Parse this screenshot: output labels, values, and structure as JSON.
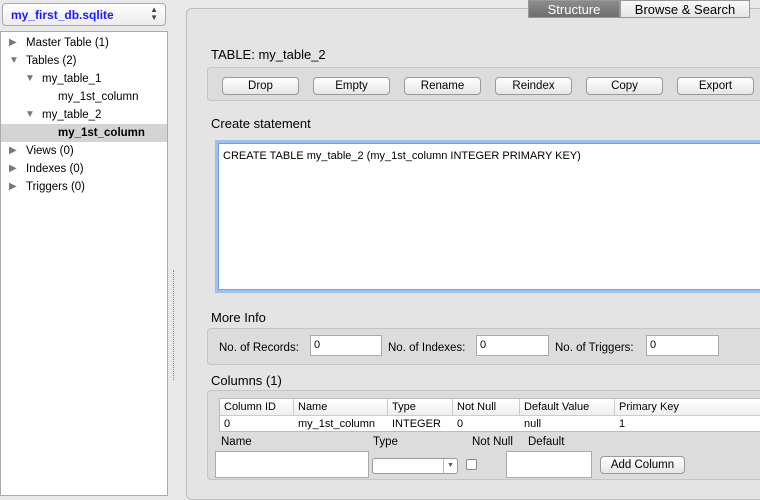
{
  "database": {
    "name": "my_first_db.sqlite"
  },
  "tree": [
    {
      "label": "Master Table (1)",
      "expanded": false,
      "level": 0
    },
    {
      "label": "Tables (2)",
      "expanded": true,
      "level": 0
    },
    {
      "label": "my_table_1",
      "expanded": true,
      "level": 1
    },
    {
      "label": "my_1st_column",
      "level": 2
    },
    {
      "label": "my_table_2",
      "expanded": true,
      "level": 1
    },
    {
      "label": "my_1st_column",
      "level": 2,
      "selected": true
    },
    {
      "label": "Views (0)",
      "expanded": false,
      "level": 0
    },
    {
      "label": "Indexes (0)",
      "expanded": false,
      "level": 0
    },
    {
      "label": "Triggers (0)",
      "expanded": false,
      "level": 0
    }
  ],
  "tabs": [
    {
      "label": "Structure",
      "active": true
    },
    {
      "label": "Browse & Search",
      "active": false
    }
  ],
  "table_title": "TABLE: my_table_2",
  "buttons": [
    "Drop",
    "Empty",
    "Rename",
    "Reindex",
    "Copy",
    "Export"
  ],
  "create": {
    "label": "Create statement",
    "sql": "CREATE TABLE my_table_2 (my_1st_column INTEGER PRIMARY KEY)"
  },
  "more_info": {
    "label": "More Info",
    "records_label": "No. of Records:",
    "records": "0",
    "indexes_label": "No. of Indexes:",
    "indexes": "0",
    "triggers_label": "No. of Triggers:",
    "triggers": "0"
  },
  "columns": {
    "label": "Columns (1)",
    "headers": [
      "Column ID",
      "Name",
      "Type",
      "Not Null",
      "Default Value",
      "Primary Key"
    ],
    "rows": [
      [
        "0",
        "my_1st_column",
        "INTEGER",
        "0",
        "null",
        "1"
      ]
    ],
    "form": {
      "name_label": "Name",
      "type_label": "Type",
      "notnull_label": "Not Null",
      "default_label": "Default",
      "add_button": "Add Column",
      "name_value": "",
      "type_value": "",
      "default_value": ""
    }
  }
}
